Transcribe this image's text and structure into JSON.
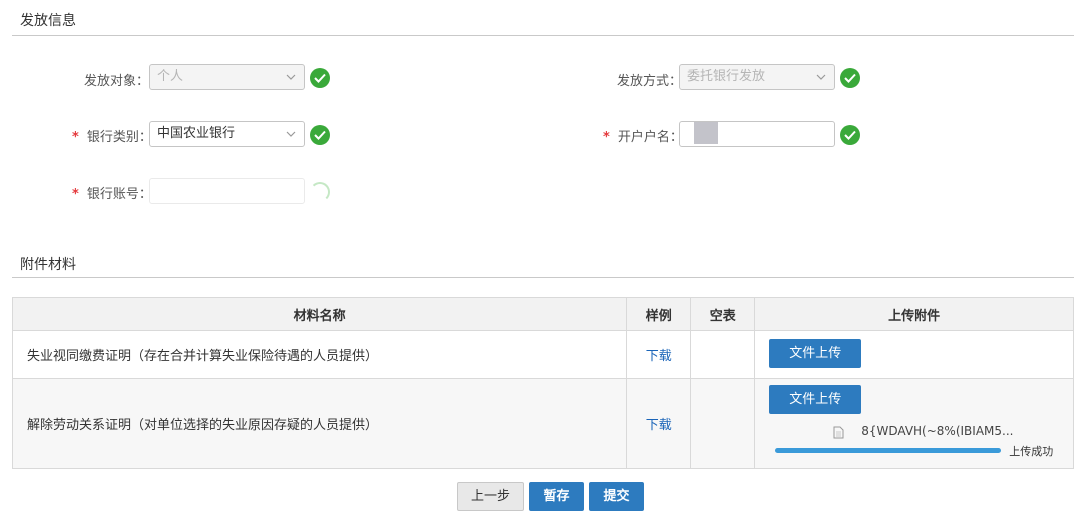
{
  "sections": {
    "payment_info_title": "发放信息",
    "attachments_title": "附件材料"
  },
  "form": {
    "payee_label": "发放对象：",
    "payee_value": "个人",
    "method_label": "发放方式：",
    "method_value": "委托银行发放",
    "bank_type_label": "银行类别：",
    "bank_type_value": "中国农业银行",
    "account_name_label": "开户户名：",
    "account_no_label": "银行账号：",
    "required_mark": "*"
  },
  "table": {
    "headers": [
      "材料名称",
      "样例",
      "空表",
      "上传附件"
    ],
    "rows": [
      {
        "name": "失业视同缴费证明（存在合并计算失业保险待遇的人员提供）",
        "sample": "下载",
        "upload_label": "文件上传"
      },
      {
        "name": "解除劳动关系证明（对单位选择的失业原因存疑的人员提供）",
        "sample": "下载",
        "upload_label": "文件上传",
        "file_name": "8{WDAVH(~8%(IBIAM5...",
        "upload_status": "上传成功",
        "upload_progress": 1.0
      }
    ]
  },
  "buttons": {
    "prev": "上一步",
    "save": "暂存",
    "submit": "提交"
  },
  "colors": {
    "primary": "#2d7bbf",
    "success": "#3aa93a",
    "required": "#e4393c",
    "link": "#1a64b8"
  }
}
